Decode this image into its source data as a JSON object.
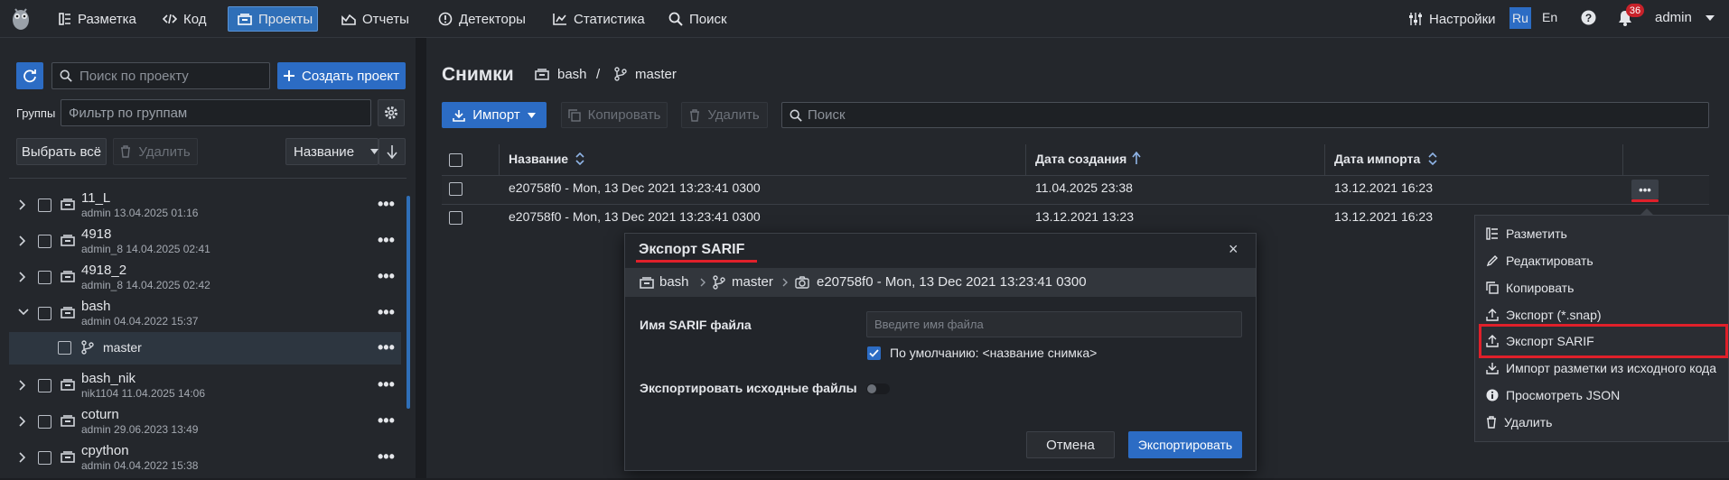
{
  "topnav": {
    "items": [
      {
        "label": "Разметка",
        "icon": "layout-icon"
      },
      {
        "label": "Код",
        "icon": "code-icon"
      },
      {
        "label": "Проекты",
        "icon": "projects-icon"
      },
      {
        "label": "Отчеты",
        "icon": "reports-icon"
      },
      {
        "label": "Детекторы",
        "icon": "detectors-icon"
      },
      {
        "label": "Статистика",
        "icon": "statistics-icon"
      },
      {
        "label": "Поиск",
        "icon": "search-icon"
      }
    ],
    "settings_label": "Настройки",
    "lang_ru": "Ru",
    "lang_en": "En",
    "notifications_count": "36",
    "user": "admin"
  },
  "left": {
    "search_placeholder": "Поиск по проекту",
    "create_project": "Создать проект",
    "groups_label": "Группы",
    "groups_placeholder": "Фильтр по группам",
    "select_all": "Выбрать всё",
    "delete": "Удалить",
    "sort_by": "Название",
    "tree": [
      {
        "name": "11_L",
        "sub": "admin 13.04.2025 01:16",
        "expanded": false
      },
      {
        "name": "4918",
        "sub": "admin_8 14.04.2025 02:41",
        "expanded": false
      },
      {
        "name": "4918_2",
        "sub": "admin_8 14.04.2025 02:42",
        "expanded": false
      },
      {
        "name": "bash",
        "sub": "admin 04.04.2022 15:37",
        "expanded": true
      },
      {
        "name": "master",
        "sub": "",
        "child": true
      },
      {
        "name": "bash_nik",
        "sub": "nik1104 11.04.2025 14:06",
        "expanded": false
      },
      {
        "name": "coturn",
        "sub": "admin 29.06.2023 13:49",
        "expanded": false
      },
      {
        "name": "cpython",
        "sub": "admin 04.04.2022 15:38",
        "expanded": false
      }
    ]
  },
  "main": {
    "title": "Снимки",
    "breadcrumb_project": "bash",
    "breadcrumb_sep": "/",
    "breadcrumb_branch": "master",
    "import": "Импорт",
    "copy": "Копировать",
    "delete": "Удалить",
    "search_placeholder": "Поиск",
    "columns": [
      "Название",
      "Дата создания",
      "Дата импорта"
    ],
    "rows": [
      {
        "name": "e20758f0 - Mon, 13 Dec 2021 13:23:41 0300",
        "created": "11.04.2025 23:38",
        "imported": "13.12.2021 16:23"
      },
      {
        "name": "e20758f0 - Mon, 13 Dec 2021 13:23:41 0300",
        "created": "13.12.2021 13:23",
        "imported": "13.12.2021 16:23"
      }
    ]
  },
  "context_menu": {
    "items": [
      {
        "label": "Разметить",
        "icon": "markup-icon"
      },
      {
        "label": "Редактировать",
        "icon": "pencil-icon"
      },
      {
        "label": "Копировать",
        "icon": "copy-icon"
      },
      {
        "label": "Экспорт (*.snap)",
        "icon": "export-icon"
      },
      {
        "label": "Экспорт SARIF",
        "icon": "export-icon",
        "highlighted": true
      },
      {
        "label": "Импорт разметки из исходного кода",
        "icon": "import-icon"
      },
      {
        "label": "Просмотреть JSON",
        "icon": "info-icon"
      },
      {
        "label": "Удалить",
        "icon": "trash-icon"
      }
    ]
  },
  "modal": {
    "title": "Экспорт SARIF",
    "crumb_project": "bash",
    "crumb_branch": "master",
    "crumb_snapshot": "e20758f0 - Mon, 13 Dec 2021 13:23:41 0300",
    "file_label": "Имя SARIF файла",
    "file_placeholder": "Введите имя файла",
    "default_checkbox": "По умолчанию: <название снимка>",
    "export_sources_label": "Экспортировать исходные файлы",
    "cancel": "Отмена",
    "export": "Экспортировать"
  },
  "colors": {
    "accent": "#2c6cc4",
    "highlight_red": "#e0202a",
    "background": "#1c1e22",
    "panel": "#24272c"
  }
}
